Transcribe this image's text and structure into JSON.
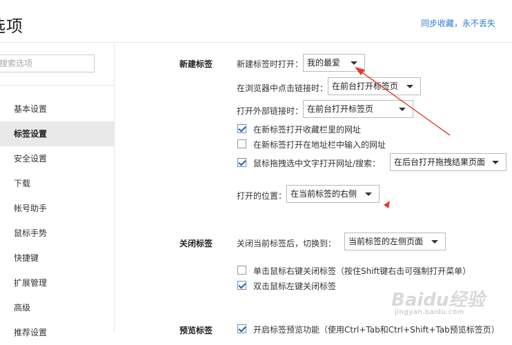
{
  "header": {
    "title": "选项",
    "sync_link": "同步收藏，永不丢失"
  },
  "sidebar": {
    "search_placeholder": "搜索选项",
    "items": [
      {
        "label": "基本设置"
      },
      {
        "label": "标签设置"
      },
      {
        "label": "安全设置"
      },
      {
        "label": "下载"
      },
      {
        "label": "帐号助手"
      },
      {
        "label": "鼠标手势"
      },
      {
        "label": "快捷键"
      },
      {
        "label": "扩展管理"
      },
      {
        "label": "高级"
      },
      {
        "label": "推荐设置"
      }
    ],
    "active_item": "标签设置"
  },
  "new_tab": {
    "section_label": "新建标签",
    "open_on_new_label": "新建标签时打开：",
    "open_on_new_value": "我的最爱",
    "middle_click_label": "在浏览器中点击链接时：",
    "middle_click_value": "在前台打开标签页",
    "external_link_label": "打开外部链接时：",
    "external_link_value": "在前台打开标签页",
    "options": [
      {
        "label": "在新标签打开收藏栏里的网址",
        "checked": true
      },
      {
        "label": "在新标签打开在地址栏中输入的网址",
        "checked": false
      },
      {
        "label": "鼠标拖拽选中文字打开网址/搜索：",
        "checked": true
      }
    ],
    "drag_search_value": "在后台打开拖拽结果页面",
    "open_position_label": "打开的位置：",
    "open_position_value": "在当前标签的右侧"
  },
  "close_tab": {
    "section_label": "关闭标签",
    "after_close_label": "关闭当前标签后，切换到：",
    "after_close_value": "当前标签的左侧页面",
    "options": [
      {
        "label": "单击鼠标右键关闭标签（按住Shift键右击可强制打开菜单）",
        "checked": false
      },
      {
        "label": "双击鼠标左键关闭标签",
        "checked": true
      }
    ]
  },
  "preview_tab": {
    "section_label": "预览标签",
    "options": [
      {
        "label": "开启标签预览功能（使用Ctrl+Tab和Ctrl+Shift+Tab预览标签页）",
        "checked": true
      }
    ]
  },
  "watermark": {
    "brand": "Baidu经验",
    "url": "jingyan.baidu.com"
  },
  "annotation_color": "#e2392f"
}
